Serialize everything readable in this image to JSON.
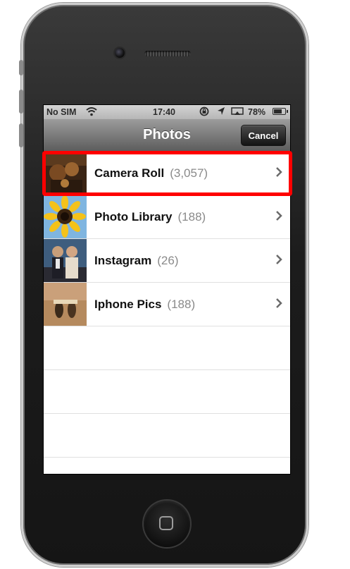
{
  "status_bar": {
    "carrier": "No SIM",
    "time": "17:40",
    "battery": "78%",
    "battery_level": 0.78,
    "icons": [
      "wifi-icon",
      "rotation-lock-icon",
      "location-icon",
      "airplay-icon",
      "battery-icon"
    ]
  },
  "nav": {
    "title": "Photos",
    "cancel_label": "Cancel"
  },
  "albums": [
    {
      "name": "Camera Roll",
      "count": "(3,057)"
    },
    {
      "name": "Photo Library",
      "count": "(188)"
    },
    {
      "name": "Instagram",
      "count": "(26)"
    },
    {
      "name": "Iphone Pics",
      "count": "(188)"
    }
  ],
  "colors": {
    "highlight": "#ff0000",
    "nav_gradient_top": "#9c9c9c",
    "nav_gradient_bottom": "#5d5d5d"
  }
}
